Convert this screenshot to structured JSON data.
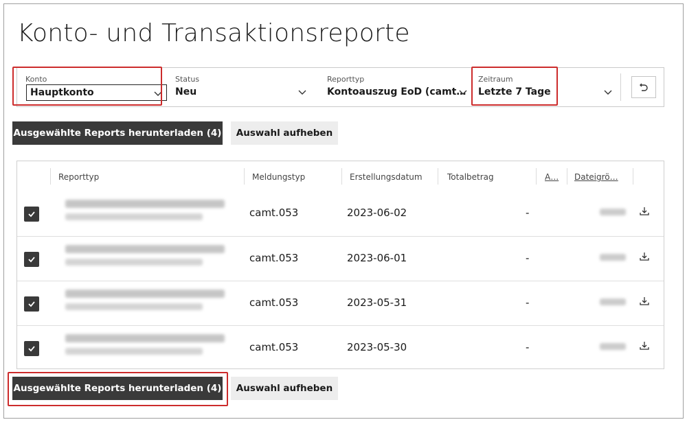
{
  "page": {
    "title": "Konto- und Transaktionsreporte"
  },
  "filters": {
    "konto": {
      "label": "Konto",
      "value": "Hauptkonto"
    },
    "status": {
      "label": "Status",
      "value": "Neu"
    },
    "reporttyp": {
      "label": "Reporttyp",
      "value": "Kontoauszug EoD (camt…"
    },
    "zeitraum": {
      "label": "Zeitraum",
      "value": "Letzte 7 Tage"
    },
    "reset_icon": "reset-icon"
  },
  "actions": {
    "download_label": "Ausgewählte Reports herunterladen (4)",
    "clear_label": "Auswahl aufheben"
  },
  "table": {
    "columns": [
      "Reporttyp",
      "Meldungstyp",
      "Erstellungsdatum",
      "Totalbetrag",
      "A…",
      "Dateigrö…"
    ],
    "rows": [
      {
        "meldungstyp": "camt.053",
        "datum": "2023-06-02",
        "totalbetrag": "-"
      },
      {
        "meldungstyp": "camt.053",
        "datum": "2023-06-01",
        "totalbetrag": "-"
      },
      {
        "meldungstyp": "camt.053",
        "datum": "2023-05-31",
        "totalbetrag": "-"
      },
      {
        "meldungstyp": "camt.053",
        "datum": "2023-05-30",
        "totalbetrag": "-"
      }
    ]
  },
  "colors": {
    "dark_button": "#3a3a3a",
    "light_button": "#ededed",
    "highlight": "#cc2b2b"
  }
}
